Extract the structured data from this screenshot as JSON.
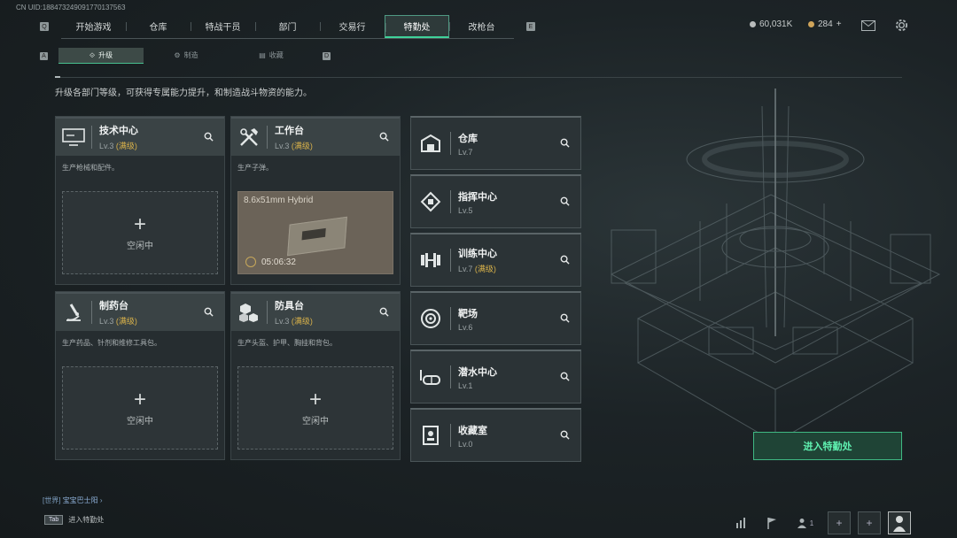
{
  "uid": "CN UID:18847324909177013756З",
  "nav": {
    "left_key": "Q",
    "right_key": "E",
    "tabs": [
      "开始游戏",
      "仓库",
      "特战干员",
      "部门",
      "交易行",
      "特勤处",
      "改枪台"
    ],
    "active_tab": "特勤处"
  },
  "currency": {
    "coins": "60,031K",
    "tickets": "284",
    "plus": "+"
  },
  "subnav": {
    "left_key": "A",
    "right_key": "D",
    "tabs": [
      "升级",
      "制造",
      "收藏"
    ],
    "active": "升级"
  },
  "description": "升级各部门等级，可获得专属能力提升，和制造战斗物资的能力。",
  "cards": [
    {
      "title": "技术中心",
      "level": "Lv.3",
      "max": "(满级)",
      "subtitle": "生产枪械和配件。",
      "slot": "空闲中"
    },
    {
      "title": "工作台",
      "level": "Lv.3",
      "max": "(满级)",
      "subtitle": "生产子弹。",
      "product": "8.6x51mm Hybrid",
      "time": "05:06:32"
    },
    {
      "title": "制药台",
      "level": "Lv.3",
      "max": "(满级)",
      "subtitle": "生产药品、针剂和维修工具包。",
      "slot": "空闲中"
    },
    {
      "title": "防具台",
      "level": "Lv.3",
      "max": "(满级)",
      "subtitle": "生产头盔、护甲、胸挂和背包。",
      "slot": "空闲中"
    }
  ],
  "facilities": [
    {
      "title": "仓库",
      "level": "Lv.7",
      "max": ""
    },
    {
      "title": "指挥中心",
      "level": "Lv.5",
      "max": ""
    },
    {
      "title": "训练中心",
      "level": "Lv.7",
      "max": "(满级)"
    },
    {
      "title": "靶场",
      "level": "Lv.6",
      "max": ""
    },
    {
      "title": "潜水中心",
      "level": "Lv.1",
      "max": ""
    },
    {
      "title": "收藏室",
      "level": "Lv.0",
      "max": ""
    }
  ],
  "enter_button": "进入特勤处",
  "chat": {
    "channel": "[世界]",
    "name": "宝宝巴士阳"
  },
  "hint": {
    "key": "Tab",
    "label": "进入特勤处"
  },
  "bottom": {
    "friends": "1"
  },
  "colors": {
    "accent": "#3fd29a",
    "max_level": "#d9b24a"
  }
}
